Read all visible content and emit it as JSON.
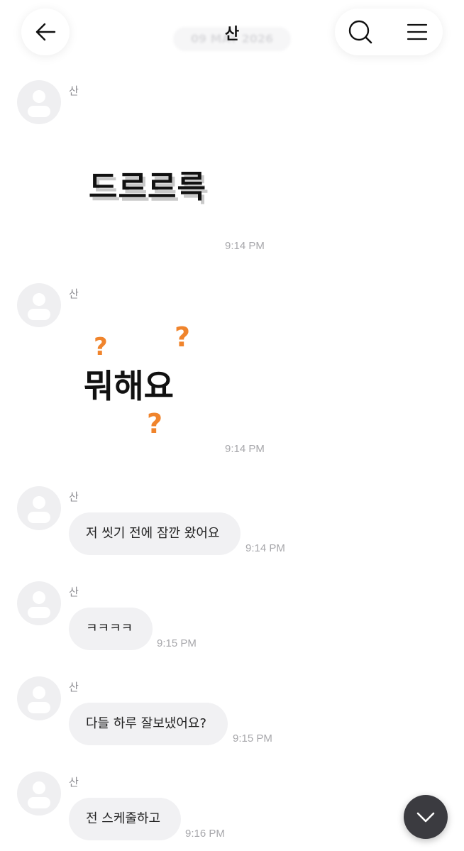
{
  "header": {
    "title": "산",
    "date_label": "09 MAY 2026"
  },
  "messages": [
    {
      "sender": "산",
      "type": "sticker",
      "sticker_text": "드르르륵",
      "time": "9:14 PM"
    },
    {
      "sender": "산",
      "type": "sticker",
      "sticker_text": "뭐해요",
      "time": "9:14 PM"
    },
    {
      "sender": "산",
      "type": "text",
      "text": "저 씻기 전에 잠깐 왔어요",
      "time": "9:14 PM"
    },
    {
      "sender": "산",
      "type": "text",
      "text": "ㅋㅋㅋㅋ",
      "time": "9:15 PM"
    },
    {
      "sender": "산",
      "type": "text",
      "text": "다들 하루 잘보냈어요?",
      "time": "9:15 PM"
    },
    {
      "sender": "산",
      "type": "text",
      "text": "전 스케줄하고",
      "time": "9:16 PM"
    }
  ],
  "icons": {
    "back": "arrow-left-icon",
    "search": "search-icon",
    "menu": "hamburger-menu-icon",
    "scroll_down": "chevron-down-icon"
  },
  "colors": {
    "bubble": "#f1f1f3",
    "accent_question": "#f0842c",
    "scroll_button": "#3b3b40"
  }
}
